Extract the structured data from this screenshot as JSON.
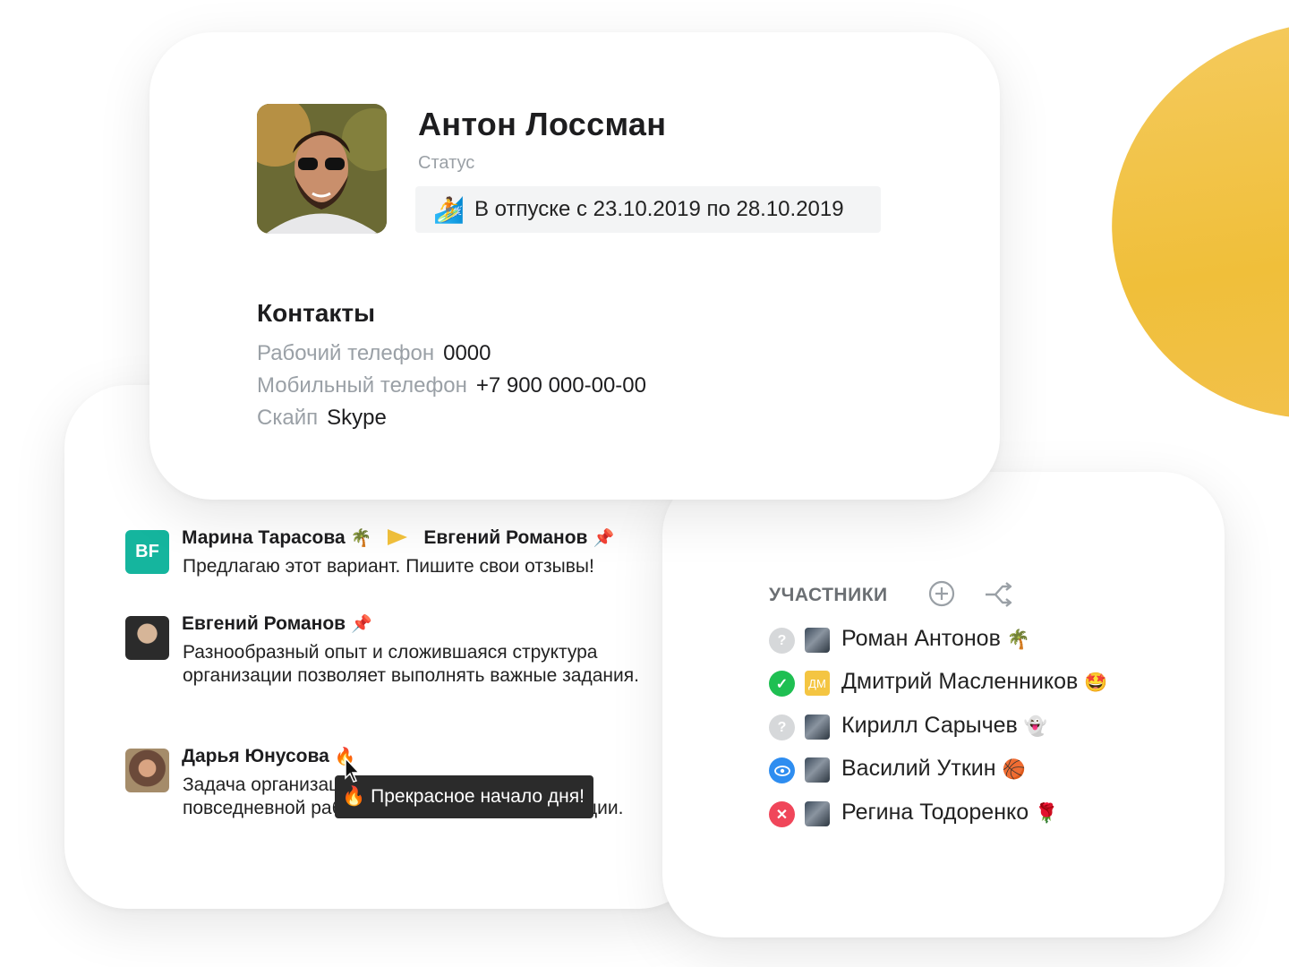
{
  "profile": {
    "name": "Антон Лоссман",
    "status_label": "Статус",
    "status_emoji": "🏄",
    "status_text": "В отпуске с 23.10.2019 по 28.10.2019",
    "contacts_title": "Контакты",
    "contacts": [
      {
        "label": "Рабочий телефон",
        "value": "0000"
      },
      {
        "label": "Мобильный телефон",
        "value": "+7 900 000-00-00"
      },
      {
        "label": "Скайп",
        "value": "Skype"
      }
    ]
  },
  "chat": {
    "messages": [
      {
        "avatar_text": "BF",
        "author": "Марина Тарасова",
        "author_emoji": "🌴",
        "recipient": "Евгений Романов",
        "recipient_emoji": "📌",
        "text": "Предлагаю этот вариант. Пишите свои отзывы!"
      },
      {
        "author": "Евгений Романов",
        "author_emoji": "📌",
        "text": "Разнообразный опыт и сложившаяся структура организации позволяет выполнять важные задания."
      },
      {
        "author": "Дарья Юнусова",
        "author_emoji": "🔥",
        "text": "Задача организации, в особенности же начало повседневной работы по формированию позиции."
      }
    ],
    "tooltip_emoji": "🔥",
    "tooltip_text": "Прекрасное начало дня!"
  },
  "members": {
    "title": "УЧАСТНИКИ",
    "list": [
      {
        "status": "unknown",
        "name": "Роман Антонов",
        "emoji": "🌴"
      },
      {
        "status": "accepted",
        "avatar_text": "ДМ",
        "name": "Дмитрий Масленников",
        "emoji": "🤩"
      },
      {
        "status": "unknown",
        "name": "Кирилл Сарычев",
        "emoji": "👻"
      },
      {
        "status": "viewed",
        "name": "Василий Уткин",
        "emoji": "🏀"
      },
      {
        "status": "declined",
        "name": "Регина Тодоренко",
        "emoji": "🌹"
      }
    ]
  },
  "colors": {
    "accent_yellow": "#F2C14A",
    "teal": "#15B59E",
    "green": "#1FBF52",
    "blue": "#2E8DF0",
    "red": "#F0465A"
  }
}
